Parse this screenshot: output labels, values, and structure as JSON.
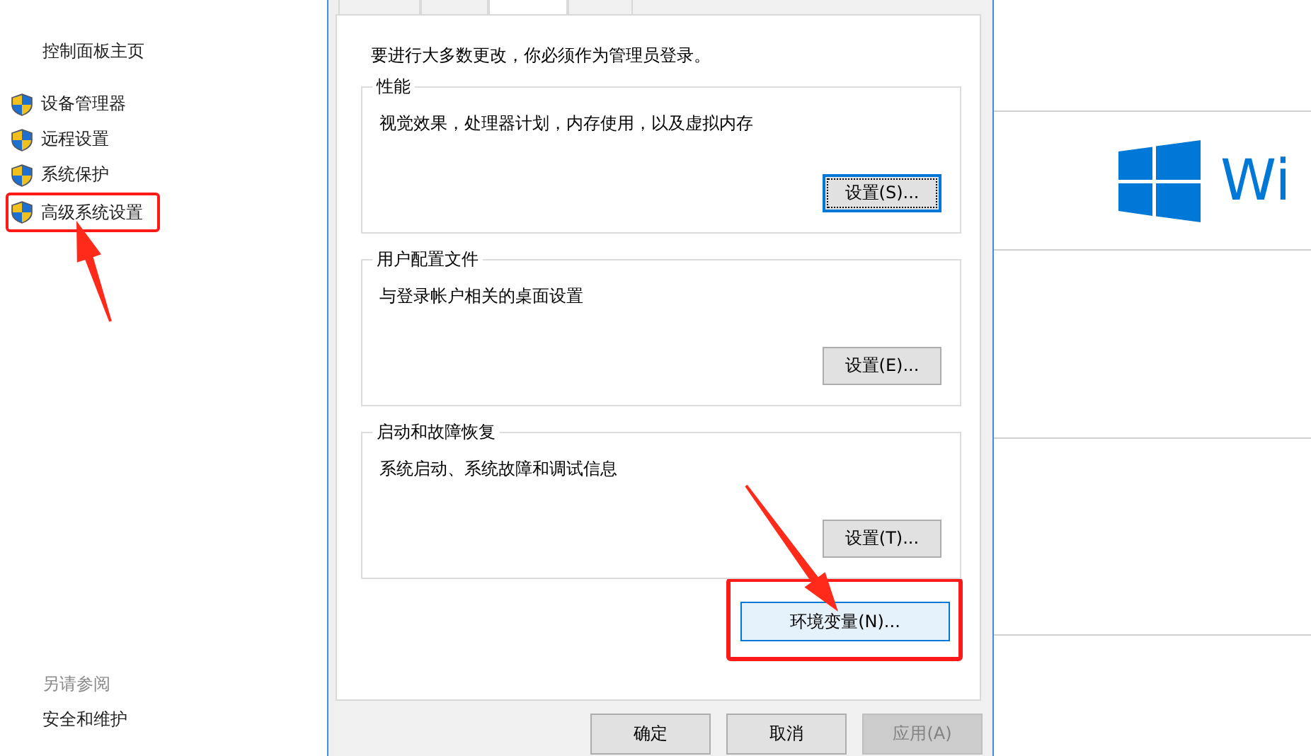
{
  "sidebar": {
    "home_link": "控制面板主页",
    "items": [
      {
        "label": "设备管理器",
        "highlighted": false
      },
      {
        "label": "远程设置",
        "highlighted": false
      },
      {
        "label": "系统保护",
        "highlighted": false
      },
      {
        "label": "高级系统设置",
        "highlighted": true
      }
    ],
    "see_also": {
      "heading": "另请参阅",
      "links": [
        "安全和维护"
      ]
    }
  },
  "dialog": {
    "tabs": [
      {
        "selected": false
      },
      {
        "selected": false
      },
      {
        "selected": true
      },
      {
        "selected": false
      }
    ],
    "note": "要进行大多数更改，你必须作为管理员登录。",
    "groups": [
      {
        "title": "性能",
        "description": "视觉效果，处理器计划，内存使用，以及虚拟内存",
        "button": "设置(S)...",
        "default": true
      },
      {
        "title": "用户配置文件",
        "description": "与登录帐户相关的桌面设置",
        "button": "设置(E)...",
        "default": false
      },
      {
        "title": "启动和故障恢复",
        "description": "系统启动、系统故障和调试信息",
        "button": "设置(T)...",
        "default": false
      }
    ],
    "env_button": {
      "label": "环境变量(N)...",
      "highlighted": true
    },
    "buttons": [
      {
        "label": "确定",
        "disabled": false
      },
      {
        "label": "取消",
        "disabled": false
      },
      {
        "label": "应用(A)",
        "disabled": true
      }
    ]
  },
  "edition_logo": {
    "text": "Wi"
  }
}
